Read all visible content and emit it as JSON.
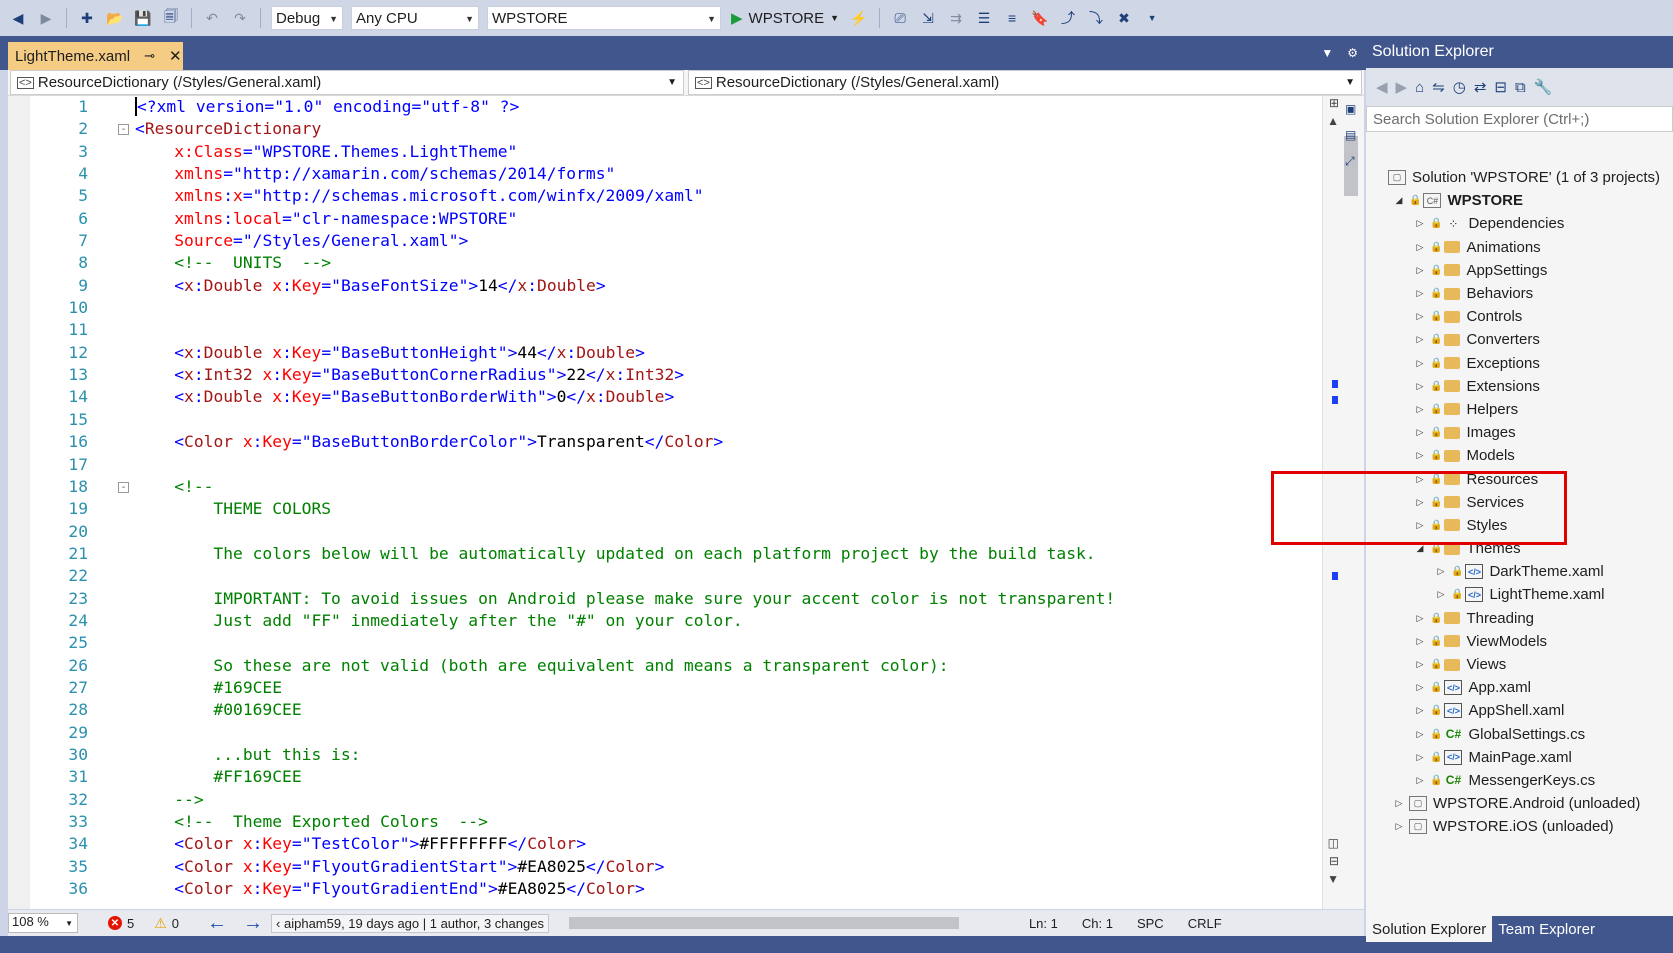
{
  "toolbar": {
    "config": "Debug",
    "platform": "Any CPU",
    "startup_project": "WPSTORE",
    "run_target": "WPSTORE"
  },
  "editor": {
    "tab_title": "LightTheme.xaml",
    "nav_left": "ResourceDictionary (/Styles/General.xaml)",
    "nav_right": "ResourceDictionary (/Styles/General.xaml)"
  },
  "code_lines": [
    {
      "n": "1",
      "fold": "",
      "segs": [
        [
          "d",
          "<?xml version=\"1.0\" encoding=\"utf-8\" ?>"
        ]
      ]
    },
    {
      "n": "2",
      "fold": "-",
      "segs": [
        [
          "d",
          "<"
        ],
        [
          "e",
          "ResourceDictionary"
        ]
      ]
    },
    {
      "n": "3",
      "fold": "",
      "segs": [
        [
          "x",
          "    "
        ],
        [
          "a",
          "x:Class"
        ],
        [
          "d",
          "=\"WPSTORE.Themes.LightTheme\""
        ]
      ]
    },
    {
      "n": "4",
      "fold": "",
      "segs": [
        [
          "x",
          "    "
        ],
        [
          "a",
          "xmlns"
        ],
        [
          "d",
          "=\"http://xamarin.com/schemas/2014/forms\""
        ]
      ]
    },
    {
      "n": "5",
      "fold": "",
      "segs": [
        [
          "x",
          "    "
        ],
        [
          "a",
          "xmlns"
        ],
        [
          "d",
          ":"
        ],
        [
          "a",
          "x"
        ],
        [
          "d",
          "=\"http://schemas.microsoft.com/winfx/2009/xaml\""
        ]
      ]
    },
    {
      "n": "6",
      "fold": "",
      "segs": [
        [
          "x",
          "    "
        ],
        [
          "a",
          "xmlns"
        ],
        [
          "d",
          ":"
        ],
        [
          "a",
          "local"
        ],
        [
          "d",
          "=\"clr-namespace:WPSTORE\""
        ]
      ]
    },
    {
      "n": "7",
      "fold": "",
      "segs": [
        [
          "x",
          "    "
        ],
        [
          "a",
          "Source"
        ],
        [
          "d",
          "=\"/Styles/General.xaml\">"
        ]
      ]
    },
    {
      "n": "8",
      "fold": "",
      "segs": [
        [
          "x",
          "    "
        ],
        [
          "c",
          "<!--  UNITS  -->"
        ]
      ]
    },
    {
      "n": "9",
      "fold": "",
      "segs": [
        [
          "x",
          "    "
        ],
        [
          "d",
          "<"
        ],
        [
          "e",
          "x"
        ],
        [
          "d",
          ":"
        ],
        [
          "e",
          "Double"
        ],
        [
          "x",
          " "
        ],
        [
          "a",
          "x"
        ],
        [
          "d",
          ":"
        ],
        [
          "a",
          "Key"
        ],
        [
          "d",
          "=\"BaseFontSize\">"
        ],
        [
          "x",
          "14"
        ],
        [
          "d",
          "</"
        ],
        [
          "e",
          "x"
        ],
        [
          "d",
          ":"
        ],
        [
          "e",
          "Double"
        ],
        [
          "d",
          ">"
        ]
      ]
    },
    {
      "n": "10",
      "fold": "",
      "segs": []
    },
    {
      "n": "11",
      "fold": "",
      "segs": []
    },
    {
      "n": "12",
      "fold": "",
      "segs": [
        [
          "x",
          "    "
        ],
        [
          "d",
          "<"
        ],
        [
          "e",
          "x"
        ],
        [
          "d",
          ":"
        ],
        [
          "e",
          "Double"
        ],
        [
          "x",
          " "
        ],
        [
          "a",
          "x"
        ],
        [
          "d",
          ":"
        ],
        [
          "a",
          "Key"
        ],
        [
          "d",
          "=\"BaseButtonHeight\">"
        ],
        [
          "x",
          "44"
        ],
        [
          "d",
          "</"
        ],
        [
          "e",
          "x"
        ],
        [
          "d",
          ":"
        ],
        [
          "e",
          "Double"
        ],
        [
          "d",
          ">"
        ]
      ]
    },
    {
      "n": "13",
      "fold": "",
      "segs": [
        [
          "x",
          "    "
        ],
        [
          "d",
          "<"
        ],
        [
          "e",
          "x"
        ],
        [
          "d",
          ":"
        ],
        [
          "e",
          "Int32"
        ],
        [
          "x",
          " "
        ],
        [
          "a",
          "x"
        ],
        [
          "d",
          ":"
        ],
        [
          "a",
          "Key"
        ],
        [
          "d",
          "=\"BaseButtonCornerRadius\">"
        ],
        [
          "x",
          "22"
        ],
        [
          "d",
          "</"
        ],
        [
          "e",
          "x"
        ],
        [
          "d",
          ":"
        ],
        [
          "e",
          "Int32"
        ],
        [
          "d",
          ">"
        ]
      ]
    },
    {
      "n": "14",
      "fold": "",
      "segs": [
        [
          "x",
          "    "
        ],
        [
          "d",
          "<"
        ],
        [
          "e",
          "x"
        ],
        [
          "d",
          ":"
        ],
        [
          "e",
          "Double"
        ],
        [
          "x",
          " "
        ],
        [
          "a",
          "x"
        ],
        [
          "d",
          ":"
        ],
        [
          "a",
          "Key"
        ],
        [
          "d",
          "=\"BaseButtonBorderWith\">"
        ],
        [
          "x",
          "0"
        ],
        [
          "d",
          "</"
        ],
        [
          "e",
          "x"
        ],
        [
          "d",
          ":"
        ],
        [
          "e",
          "Double"
        ],
        [
          "d",
          ">"
        ]
      ]
    },
    {
      "n": "15",
      "fold": "",
      "segs": []
    },
    {
      "n": "16",
      "fold": "",
      "segs": [
        [
          "x",
          "    "
        ],
        [
          "d",
          "<"
        ],
        [
          "e",
          "Color"
        ],
        [
          "x",
          " "
        ],
        [
          "a",
          "x"
        ],
        [
          "d",
          ":"
        ],
        [
          "a",
          "Key"
        ],
        [
          "d",
          "=\"BaseButtonBorderColor\">"
        ],
        [
          "x",
          "Transparent"
        ],
        [
          "d",
          "</"
        ],
        [
          "e",
          "Color"
        ],
        [
          "d",
          ">"
        ]
      ]
    },
    {
      "n": "17",
      "fold": "",
      "segs": []
    },
    {
      "n": "18",
      "fold": "-",
      "segs": [
        [
          "x",
          "    "
        ],
        [
          "c",
          "<!--"
        ]
      ]
    },
    {
      "n": "19",
      "fold": "",
      "segs": [
        [
          "x",
          "        "
        ],
        [
          "c",
          "THEME COLORS"
        ]
      ]
    },
    {
      "n": "20",
      "fold": "",
      "segs": []
    },
    {
      "n": "21",
      "fold": "",
      "segs": [
        [
          "x",
          "        "
        ],
        [
          "c",
          "The colors below will be automatically updated on each platform project by the build task."
        ]
      ]
    },
    {
      "n": "22",
      "fold": "",
      "segs": []
    },
    {
      "n": "23",
      "fold": "",
      "segs": [
        [
          "x",
          "        "
        ],
        [
          "c",
          "IMPORTANT: To avoid issues on Android please make sure your accent color is not transparent!"
        ]
      ]
    },
    {
      "n": "24",
      "fold": "",
      "segs": [
        [
          "x",
          "        "
        ],
        [
          "c",
          "Just add \"FF\" inmediately after the \"#\" on your color."
        ]
      ]
    },
    {
      "n": "25",
      "fold": "",
      "segs": []
    },
    {
      "n": "26",
      "fold": "",
      "segs": [
        [
          "x",
          "        "
        ],
        [
          "c",
          "So these are not valid (both are equivalent and means a transparent color):"
        ]
      ]
    },
    {
      "n": "27",
      "fold": "",
      "segs": [
        [
          "x",
          "        "
        ],
        [
          "c",
          "#169CEE"
        ]
      ]
    },
    {
      "n": "28",
      "fold": "",
      "segs": [
        [
          "x",
          "        "
        ],
        [
          "c",
          "#00169CEE"
        ]
      ]
    },
    {
      "n": "29",
      "fold": "",
      "segs": []
    },
    {
      "n": "30",
      "fold": "",
      "segs": [
        [
          "x",
          "        "
        ],
        [
          "c",
          "...but this is:"
        ]
      ]
    },
    {
      "n": "31",
      "fold": "",
      "segs": [
        [
          "x",
          "        "
        ],
        [
          "c",
          "#FF169CEE"
        ]
      ]
    },
    {
      "n": "32",
      "fold": "",
      "segs": [
        [
          "x",
          "    "
        ],
        [
          "c",
          "-->"
        ]
      ]
    },
    {
      "n": "33",
      "fold": "",
      "segs": [
        [
          "x",
          "    "
        ],
        [
          "c",
          "<!--  Theme Exported Colors  -->"
        ]
      ]
    },
    {
      "n": "34",
      "fold": "",
      "segs": [
        [
          "x",
          "    "
        ],
        [
          "d",
          "<"
        ],
        [
          "e",
          "Color"
        ],
        [
          "x",
          " "
        ],
        [
          "a",
          "x"
        ],
        [
          "d",
          ":"
        ],
        [
          "a",
          "Key"
        ],
        [
          "d",
          "=\"TestColor\">"
        ],
        [
          "x",
          "#FFFFFFFF"
        ],
        [
          "d",
          "</"
        ],
        [
          "e",
          "Color"
        ],
        [
          "d",
          ">"
        ]
      ]
    },
    {
      "n": "35",
      "fold": "",
      "segs": [
        [
          "x",
          "    "
        ],
        [
          "d",
          "<"
        ],
        [
          "e",
          "Color"
        ],
        [
          "x",
          " "
        ],
        [
          "a",
          "x"
        ],
        [
          "d",
          ":"
        ],
        [
          "a",
          "Key"
        ],
        [
          "d",
          "=\"FlyoutGradientStart\">"
        ],
        [
          "x",
          "#EA8025"
        ],
        [
          "d",
          "</"
        ],
        [
          "e",
          "Color"
        ],
        [
          "d",
          ">"
        ]
      ]
    },
    {
      "n": "36",
      "fold": "",
      "segs": [
        [
          "x",
          "    "
        ],
        [
          "d",
          "<"
        ],
        [
          "e",
          "Color"
        ],
        [
          "x",
          " "
        ],
        [
          "a",
          "x"
        ],
        [
          "d",
          ":"
        ],
        [
          "a",
          "Key"
        ],
        [
          "d",
          "=\"FlyoutGradientEnd\">"
        ],
        [
          "x",
          "#EA8025"
        ],
        [
          "d",
          "</"
        ],
        [
          "e",
          "Color"
        ],
        [
          "d",
          ">"
        ]
      ]
    }
  ],
  "statusbar": {
    "zoom": "108 %",
    "errors": "5",
    "warnings": "0",
    "blame": "aipham59, 19 days ago | 1 author, 3 changes",
    "ln": "Ln: 1",
    "ch": "Ch: 1",
    "ws": "SPC",
    "eol": "CRLF"
  },
  "solution_explorer": {
    "title": "Solution Explorer",
    "search_placeholder": "Search Solution Explorer (Ctrl+;)",
    "tree": [
      {
        "label": "Solution 'WPSTORE' (1 of 3 projects)",
        "level": 0,
        "exp": "",
        "icon": "solution-icon",
        "kind": "sln",
        "bold": false
      },
      {
        "label": "WPSTORE",
        "level": 1,
        "exp": "open",
        "icon": "csharp-project-icon",
        "kind": "proj",
        "bold": true
      },
      {
        "label": "Dependencies",
        "level": 2,
        "exp": "closed",
        "icon": "dependencies-icon",
        "kind": "dep",
        "bold": false
      },
      {
        "label": "Animations",
        "level": 2,
        "exp": "closed",
        "icon": "folder-icon",
        "kind": "folder",
        "bold": false
      },
      {
        "label": "AppSettings",
        "level": 2,
        "exp": "closed",
        "icon": "folder-icon",
        "kind": "folder",
        "bold": false
      },
      {
        "label": "Behaviors",
        "level": 2,
        "exp": "closed",
        "icon": "folder-icon",
        "kind": "folder",
        "bold": false
      },
      {
        "label": "Controls",
        "level": 2,
        "exp": "closed",
        "icon": "folder-icon",
        "kind": "folder",
        "bold": false
      },
      {
        "label": "Converters",
        "level": 2,
        "exp": "closed",
        "icon": "folder-icon",
        "kind": "folder",
        "bold": false
      },
      {
        "label": "Exceptions",
        "level": 2,
        "exp": "closed",
        "icon": "folder-icon",
        "kind": "folder",
        "bold": false
      },
      {
        "label": "Extensions",
        "level": 2,
        "exp": "closed",
        "icon": "folder-icon",
        "kind": "folder",
        "bold": false
      },
      {
        "label": "Helpers",
        "level": 2,
        "exp": "closed",
        "icon": "folder-icon",
        "kind": "folder",
        "bold": false
      },
      {
        "label": "Images",
        "level": 2,
        "exp": "closed",
        "icon": "folder-icon",
        "kind": "folder",
        "bold": false
      },
      {
        "label": "Models",
        "level": 2,
        "exp": "closed",
        "icon": "folder-icon",
        "kind": "folder",
        "bold": false
      },
      {
        "label": "Resources",
        "level": 2,
        "exp": "closed",
        "icon": "folder-icon",
        "kind": "folder",
        "bold": false
      },
      {
        "label": "Services",
        "level": 2,
        "exp": "closed",
        "icon": "folder-icon",
        "kind": "folder",
        "bold": false
      },
      {
        "label": "Styles",
        "level": 2,
        "exp": "closed",
        "icon": "folder-icon",
        "kind": "folder",
        "bold": false
      },
      {
        "label": "Themes",
        "level": 2,
        "exp": "open",
        "icon": "open-folder-icon",
        "kind": "folder",
        "bold": false,
        "selected": true
      },
      {
        "label": "DarkTheme.xaml",
        "level": 3,
        "exp": "closed",
        "icon": "xaml-file-icon",
        "kind": "xaml",
        "bold": false
      },
      {
        "label": "LightTheme.xaml",
        "level": 3,
        "exp": "closed",
        "icon": "xaml-file-icon",
        "kind": "xaml",
        "bold": false
      },
      {
        "label": "Threading",
        "level": 2,
        "exp": "closed",
        "icon": "folder-icon",
        "kind": "folder",
        "bold": false
      },
      {
        "label": "ViewModels",
        "level": 2,
        "exp": "closed",
        "icon": "folder-icon",
        "kind": "folder",
        "bold": false
      },
      {
        "label": "Views",
        "level": 2,
        "exp": "closed",
        "icon": "folder-icon",
        "kind": "folder",
        "bold": false
      },
      {
        "label": "App.xaml",
        "level": 2,
        "exp": "closed",
        "icon": "xaml-file-icon",
        "kind": "xaml",
        "bold": false
      },
      {
        "label": "AppShell.xaml",
        "level": 2,
        "exp": "closed",
        "icon": "xaml-file-icon",
        "kind": "xaml",
        "bold": false
      },
      {
        "label": "GlobalSettings.cs",
        "level": 2,
        "exp": "closed",
        "icon": "csharp-file-icon",
        "kind": "cs",
        "bold": false
      },
      {
        "label": "MainPage.xaml",
        "level": 2,
        "exp": "closed",
        "icon": "xaml-file-icon",
        "kind": "xaml",
        "bold": false
      },
      {
        "label": "MessengerKeys.cs",
        "level": 2,
        "exp": "closed",
        "icon": "csharp-file-icon",
        "kind": "cs",
        "bold": false
      },
      {
        "label": "WPSTORE.Android (unloaded)",
        "level": 1,
        "exp": "closed",
        "icon": "unloaded-project-icon",
        "kind": "unloaded",
        "bold": false
      },
      {
        "label": "WPSTORE.iOS (unloaded)",
        "level": 1,
        "exp": "closed",
        "icon": "unloaded-project-icon",
        "kind": "unloaded",
        "bold": false
      }
    ],
    "tab_solution": "Solution Explorer",
    "tab_team": "Team Explorer"
  },
  "colors": {
    "frame": "#40568d",
    "tab_active": "#f5cc84",
    "highlight_box": "#e00000",
    "comment": "#008000",
    "element": "#a31515",
    "attribute": "#ff0000",
    "delimiter": "#0000ff",
    "line_number": "#2b91af"
  }
}
